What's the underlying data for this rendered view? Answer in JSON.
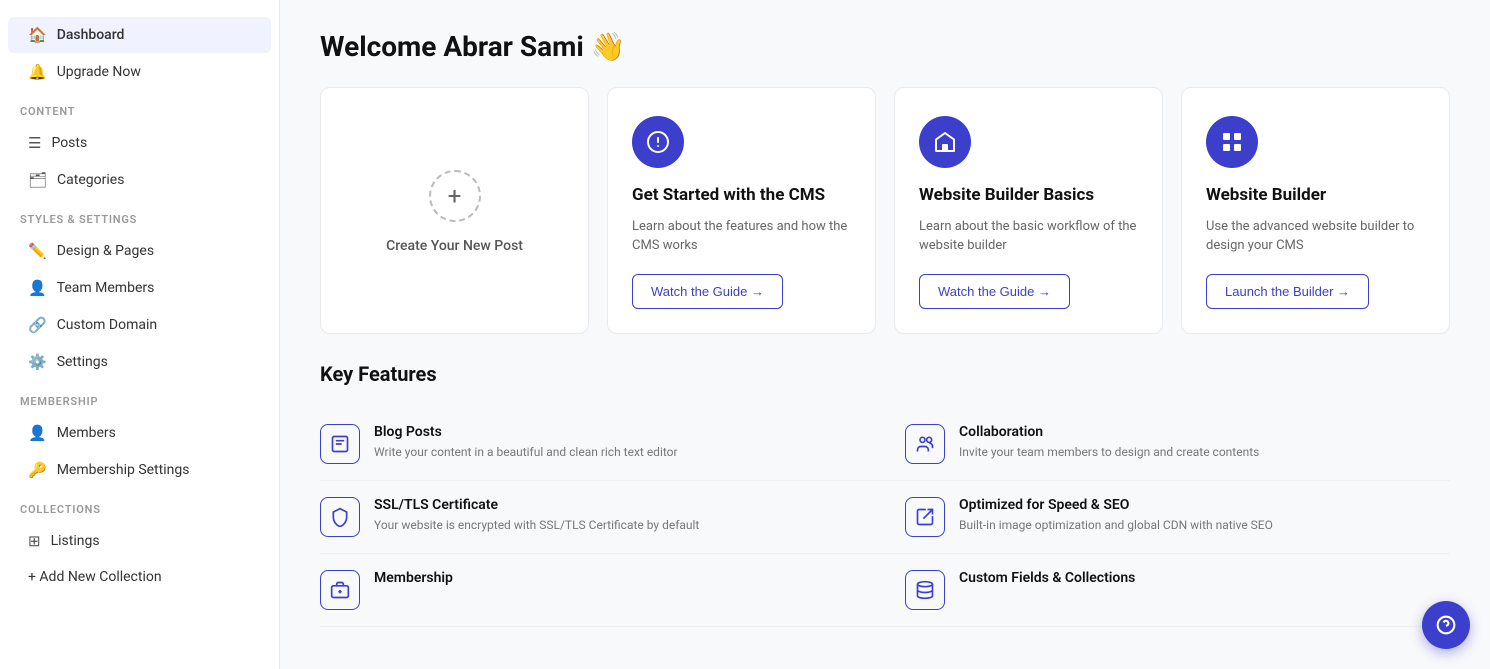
{
  "sidebar": {
    "dashboard_label": "Dashboard",
    "upgrade_label": "Upgrade Now",
    "content_section": "CONTENT",
    "posts_label": "Posts",
    "categories_label": "Categories",
    "styles_section": "STYLES & SETTINGS",
    "design_pages_label": "Design & Pages",
    "team_members_label": "Team Members",
    "custom_domain_label": "Custom Domain",
    "settings_label": "Settings",
    "membership_section": "MEMBERSHIP",
    "members_label": "Members",
    "membership_settings_label": "Membership Settings",
    "collections_section": "COLLECTIONS",
    "listings_label": "Listings",
    "add_collection_label": "+ Add New Collection"
  },
  "main": {
    "welcome_title": "Welcome Abrar Sami 👋",
    "card_create": {
      "label": "Create Your New Post"
    },
    "card1": {
      "title": "Get Started with the CMS",
      "desc": "Learn about the features and how the CMS works",
      "btn": "Watch the Guide →"
    },
    "card2": {
      "title": "Website Builder Basics",
      "desc": "Learn about the basic workflow of the website builder",
      "btn": "Watch the Guide →"
    },
    "card3": {
      "title": "Website Builder",
      "desc": "Use the advanced website builder to design your CMS",
      "btn": "Launch the Builder →"
    },
    "key_features_title": "Key Features",
    "features": [
      {
        "title": "Blog Posts",
        "desc": "Write your content in a beautiful and clean rich text editor"
      },
      {
        "title": "Collaboration",
        "desc": "Invite your team members to design and create contents"
      },
      {
        "title": "SSL/TLS Certificate",
        "desc": "Your website is encrypted with SSL/TLS Certificate by default"
      },
      {
        "title": "Optimized for Speed & SEO",
        "desc": "Built-in image optimization and global CDN with native SEO"
      },
      {
        "title": "Membership",
        "desc": ""
      },
      {
        "title": "Custom Fields & Collections",
        "desc": ""
      }
    ]
  }
}
